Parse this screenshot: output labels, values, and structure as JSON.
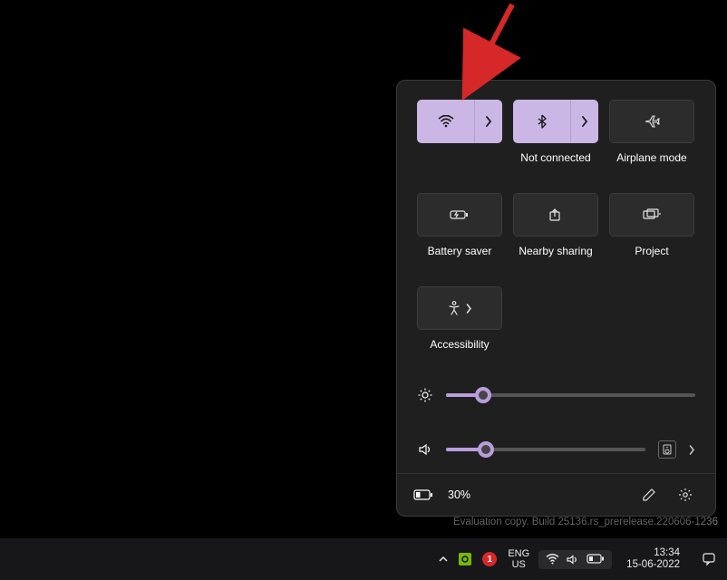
{
  "quick_settings": {
    "tiles": [
      {
        "id": "wifi",
        "label": "",
        "active": true,
        "expandable": true
      },
      {
        "id": "bluetooth",
        "label": "Not connected",
        "active": true,
        "expandable": true
      },
      {
        "id": "airplane",
        "label": "Airplane mode",
        "active": false,
        "expandable": false
      },
      {
        "id": "battery_saver",
        "label": "Battery saver",
        "active": false,
        "expandable": false
      },
      {
        "id": "nearby_sharing",
        "label": "Nearby sharing",
        "active": false,
        "expandable": true
      },
      {
        "id": "project",
        "label": "Project",
        "active": false,
        "expandable": true
      },
      {
        "id": "accessibility",
        "label": "Accessibility",
        "active": false,
        "expandable": true
      }
    ],
    "brightness_pct": 15,
    "volume_pct": 20,
    "battery_text": "30%"
  },
  "watermark": "Evaluation copy. Build 25136.rs_prerelease.220606-1236",
  "taskbar": {
    "overflow_chevron": "^",
    "update_badge": "1",
    "lang_top": "ENG",
    "lang_bot": "US",
    "time": "13:34",
    "date": "15-06-2022"
  }
}
